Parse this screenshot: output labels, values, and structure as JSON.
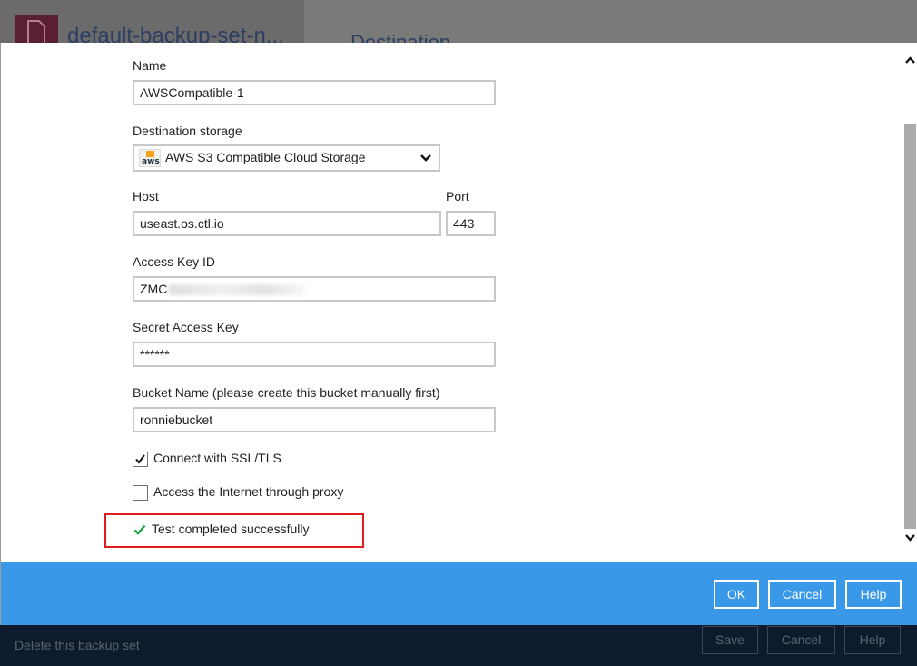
{
  "background": {
    "title": "default-backup-set-n...",
    "tab": "Destination",
    "footer": {
      "delete_label": "Delete this backup set",
      "save_label": "Save",
      "cancel_label": "Cancel",
      "help_label": "Help"
    }
  },
  "form": {
    "name": {
      "label": "Name",
      "value": "AWSCompatible-1"
    },
    "destination_storage": {
      "label": "Destination storage",
      "value": "AWS S3 Compatible Cloud Storage",
      "logo_text": "aws"
    },
    "host": {
      "label": "Host",
      "value": "useast.os.ctl.io"
    },
    "port": {
      "label": "Port",
      "value": "443"
    },
    "access_key": {
      "label": "Access Key ID",
      "value": "ZMC"
    },
    "secret_key": {
      "label": "Secret Access Key",
      "value": "******"
    },
    "bucket": {
      "label": "Bucket Name (please create this bucket manually first)",
      "value": "ronniebucket"
    },
    "ssl": {
      "label": "Connect with SSL/TLS",
      "checked": true
    },
    "proxy": {
      "label": "Access the Internet through proxy",
      "checked": false
    },
    "status": {
      "text": "Test completed successfully"
    }
  },
  "footer": {
    "ok_label": "OK",
    "cancel_label": "Cancel",
    "help_label": "Help"
  },
  "colors": {
    "accent": "#3a98e9",
    "success": "#1aa34a",
    "highlight": "#e01b1b"
  }
}
